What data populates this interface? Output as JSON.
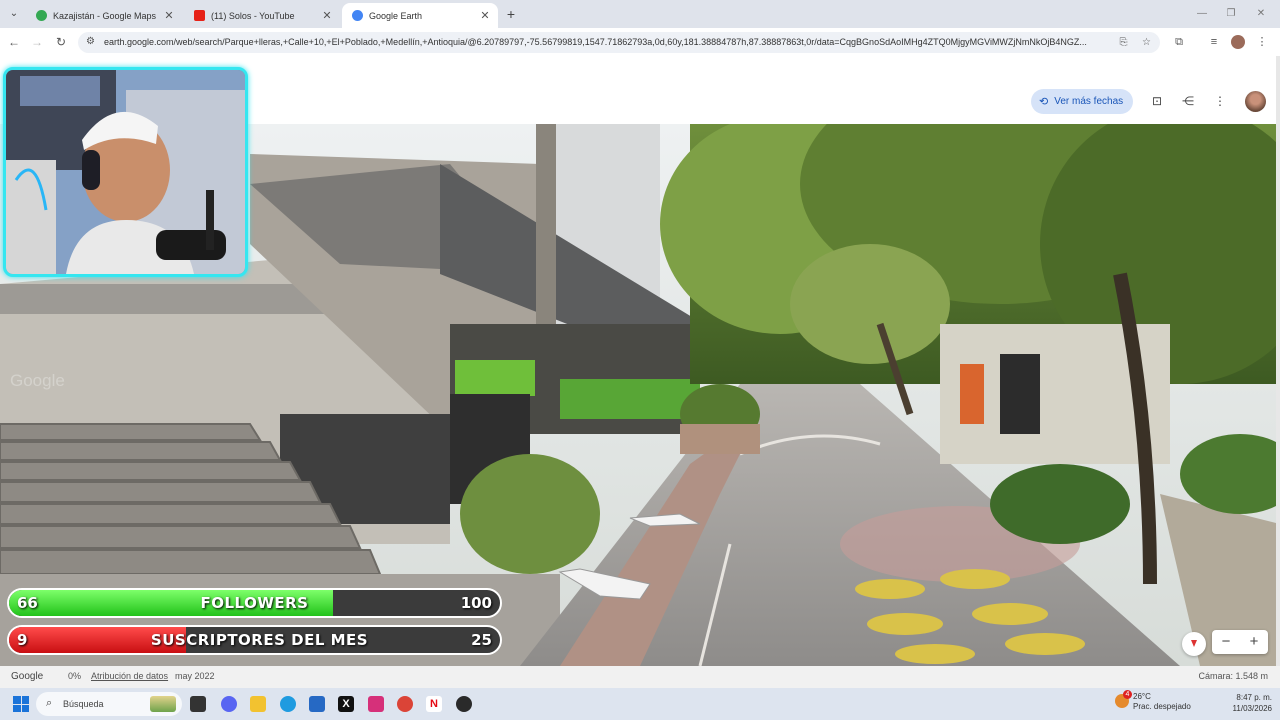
{
  "browser": {
    "tabs": [
      {
        "label": "Kazajistán - Google Maps",
        "favicon_color": "#34a853",
        "active": false
      },
      {
        "label": "(11) Solos - YouTube",
        "favicon_color": "#e62117",
        "active": false
      },
      {
        "label": "Google Earth",
        "favicon_color": "#4285f4",
        "active": true
      }
    ],
    "url": "earth.google.com/web/search/Parque+lleras,+Calle+10,+El+Poblado,+Medellín,+Antioquia/@6.20789797,-75.56799819,1547.71862793a,0d,60y,181.38884787h,87.38887863t,0r/data=CqgBGnoSdAoIMHg4ZTQ0MjgyMGViMWZjNmNkOjB4NGZ..."
  },
  "earth": {
    "more_dates_label": "Ver más fechas",
    "status": {
      "logo": "Google",
      "percent": "0%",
      "attribution": "Atribución de datos",
      "date": "may 2022",
      "camera": "Cámara: 1.548 m"
    },
    "zoom_out": "−",
    "zoom_in": "+"
  },
  "overlay": {
    "followers": {
      "current": "66",
      "label": "FOLLOWERS",
      "goal": "100",
      "progress": 0.66,
      "color": "#22c21a"
    },
    "subscribers": {
      "current": "9",
      "label": "SUSCRIPTORES DEL MES",
      "goal": "25",
      "progress": 0.36,
      "color": "#c90f12"
    }
  },
  "taskbar": {
    "search_placeholder": "Búsqueda",
    "weather_temp": "26°C",
    "weather_desc": "Prac. despejado",
    "weather_badge": "4",
    "time": "8:47 p. m.",
    "date": "11/03/2026"
  }
}
